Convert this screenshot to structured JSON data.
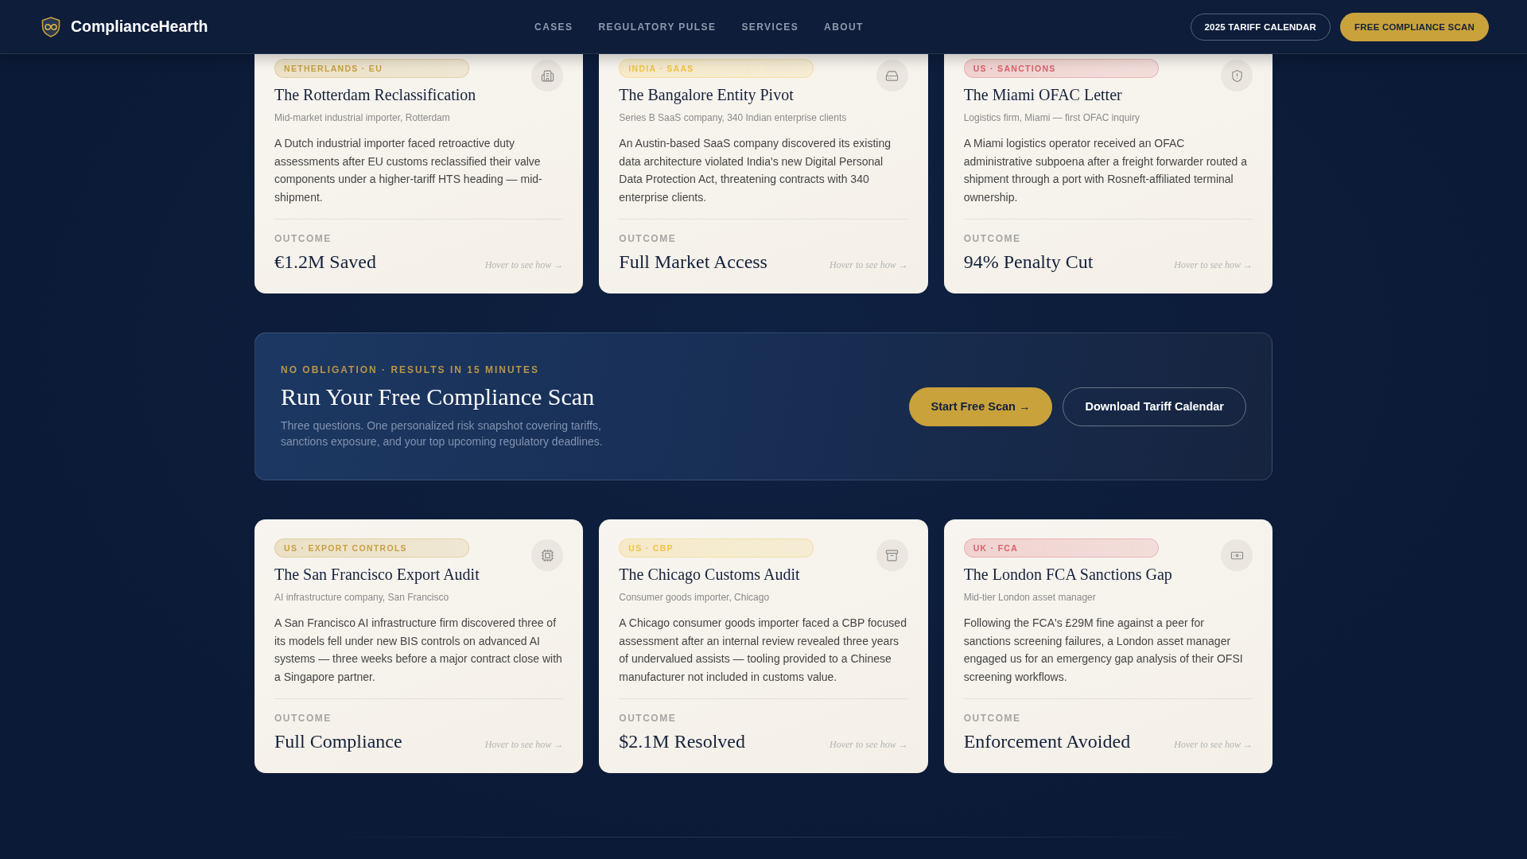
{
  "header": {
    "brand": "ComplianceHearth",
    "nav": [
      "CASES",
      "REGULATORY PULSE",
      "SERVICES",
      "ABOUT"
    ],
    "actions": [
      {
        "label": "2025 TARIFF CALENDAR",
        "kind": "outline"
      },
      {
        "label": "FREE COMPLIANCE SCAN",
        "kind": "primary"
      }
    ]
  },
  "sections": [
    {
      "kind": "cases",
      "cards": [
        {
          "tag": "NETHERLANDS · EU",
          "color": "#c7a043",
          "title": "The Rotterdam Reclassification",
          "client": "Mid-market industrial importer, Rotterdam",
          "summary": "A Dutch industrial importer faced retroactive duty assessments after EU customs reclassified their valve components under a higher-tariff HTS heading — mid-shipment.",
          "outcome_label": "OUTCOME",
          "outcome": "€1.2M Saved",
          "hint": "Hover to see how →"
        },
        {
          "tag": "INDIA · SAAS",
          "color": "#f0c447",
          "title": "The Bangalore Entity Pivot",
          "client": "Series B SaaS company, 340 Indian enterprise clients",
          "summary": "An Austin-based SaaS company discovered its existing data architecture violated India's new Digital Personal Data Protection Act, threatening contracts with 340 enterprise clients.",
          "outcome_label": "OUTCOME",
          "outcome": "Full Market Access",
          "hint": "Hover to see how →"
        },
        {
          "tag": "US · SANCTIONS",
          "color": "#d9626a",
          "title": "The Miami OFAC Letter",
          "client": "Logistics firm, Miami — first OFAC inquiry",
          "summary": "A Miami logistics operator received an OFAC administrative subpoena after a freight forwarder routed a shipment through a port with Rosneft-affiliated terminal ownership.",
          "outcome_label": "OUTCOME",
          "outcome": "94% Penalty Cut",
          "hint": "Hover to see how →"
        }
      ]
    },
    {
      "kind": "cta",
      "eyebrow": "NO OBLIGATION · RESULTS IN 15 MINUTES",
      "title": "Run Your Free Compliance Scan",
      "text": "Three questions. One personalized risk snapshot covering tariffs, sanctions exposure, and your top upcoming regulatory deadlines.",
      "buttons": [
        {
          "label": "Start Free Scan →",
          "kind": "primary"
        },
        {
          "label": "Download Tariff Calendar",
          "kind": "outline"
        }
      ]
    },
    {
      "kind": "cases",
      "cards": [
        {
          "tag": "US · EXPORT CONTROLS",
          "color": "#c7a043",
          "title": "The San Francisco Export Audit",
          "client": "AI infrastructure company, San Francisco",
          "summary": "A San Francisco AI infrastructure firm discovered three of its models fell under new BIS controls on advanced AI systems — three weeks before a major contract close with a Singapore partner.",
          "outcome_label": "OUTCOME",
          "outcome": "Full Compliance",
          "hint": "Hover to see how →"
        },
        {
          "tag": "US · CBP",
          "color": "#f0c447",
          "title": "The Chicago Customs Audit",
          "client": "Consumer goods importer, Chicago",
          "summary": "A Chicago consumer goods importer faced a CBP focused assessment after an internal review revealed three years of undervalued assists — tooling provided to a Chinese manufacturer not included in customs value.",
          "outcome_label": "OUTCOME",
          "outcome": "$2.1M Resolved",
          "hint": "Hover to see how →"
        },
        {
          "tag": "UK · FCA",
          "color": "#d9626a",
          "title": "The London FCA Sanctions Gap",
          "client": "Mid-tier London asset manager",
          "summary": "Following the FCA's £29M fine against a peer for sanctions screening failures, a London asset manager engaged us for an emergency gap analysis of their OFSI screening workflows.",
          "outcome_label": "OUTCOME",
          "outcome": "Enforcement Avoided",
          "hint": "Hover to see how →"
        }
      ]
    }
  ]
}
